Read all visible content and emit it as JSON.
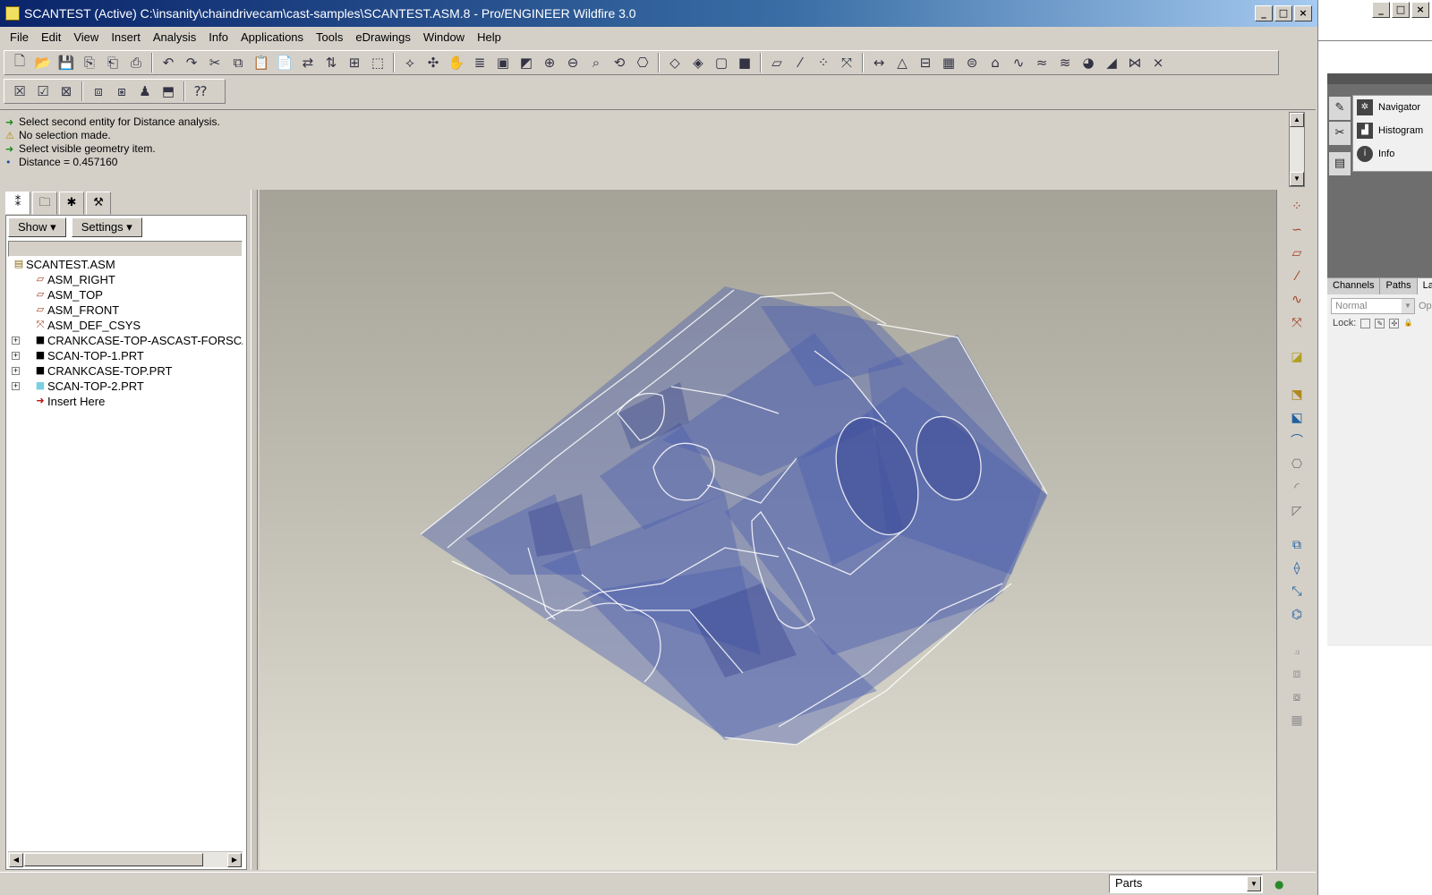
{
  "window": {
    "title": "SCANTEST (Active) C:\\insanity\\chaindrivecam\\cast-samples\\SCANTEST.ASM.8 - Pro/ENGINEER Wildfire 3.0",
    "minimize": "_",
    "maximize": "□",
    "close": "×"
  },
  "menu": [
    "File",
    "Edit",
    "View",
    "Insert",
    "Analysis",
    "Info",
    "Applications",
    "Tools",
    "eDrawings",
    "Window",
    "Help"
  ],
  "toolbar": {
    "icons": [
      "new-icon",
      "open-icon",
      "save-icon",
      "print-icon",
      "undo-icon",
      "redo-icon",
      "cut-icon",
      "copy-icon",
      "paste-icon",
      "regenerate-icon",
      "find-icon",
      "select-box-icon",
      "datum-icon",
      "orient-icon",
      "pan-icon",
      "layer-icon",
      "repaint-icon",
      "zoom-in-icon",
      "zoom-out-icon",
      "refit-icon",
      "spin-center-icon",
      "named-views-icon",
      "wireframe-icon",
      "hidden-line-icon",
      "no-hidden-icon",
      "shaded-icon",
      "datum-planes-icon",
      "datum-axes-icon",
      "datum-points-icon",
      "csys-icon",
      "measure-icon",
      "model-analysis-icon",
      "curve-analysis-icon",
      "surface-analysis-icon"
    ]
  },
  "messages": [
    {
      "icon": "arrow",
      "text": "Select second entity for Distance analysis."
    },
    {
      "icon": "warning",
      "text": "No selection made."
    },
    {
      "icon": "arrow",
      "text": "Select visible geometry item."
    },
    {
      "icon": "bullet",
      "text": "Distance = 0.457160"
    }
  ],
  "tree": {
    "show_label": "Show",
    "settings_label": "Settings",
    "items": [
      {
        "label": "SCANTEST.ASM",
        "icon": "assembly-icon",
        "level": 0,
        "expandable": false
      },
      {
        "label": "ASM_RIGHT",
        "icon": "datum-plane-icon",
        "level": 1,
        "expandable": false
      },
      {
        "label": "ASM_TOP",
        "icon": "datum-plane-icon",
        "level": 1,
        "expandable": false
      },
      {
        "label": "ASM_FRONT",
        "icon": "datum-plane-icon",
        "level": 1,
        "expandable": false
      },
      {
        "label": "ASM_DEF_CSYS",
        "icon": "csys-icon",
        "level": 1,
        "expandable": false
      },
      {
        "label": "CRANKCASE-TOP-ASCAST-FORSCAN",
        "icon": "part-black-icon",
        "level": 1,
        "expandable": true
      },
      {
        "label": "SCAN-TOP-1.PRT",
        "icon": "part-black-icon",
        "level": 1,
        "expandable": true
      },
      {
        "label": "CRANKCASE-TOP.PRT",
        "icon": "part-black-icon",
        "level": 1,
        "expandable": true
      },
      {
        "label": "SCAN-TOP-2.PRT",
        "icon": "part-cyan-icon",
        "level": 1,
        "expandable": true
      },
      {
        "label": "Insert Here",
        "icon": "insert-arrow-icon",
        "level": 1,
        "expandable": false
      }
    ]
  },
  "status": {
    "filter_value": "Parts"
  },
  "side_window": {
    "panels": [
      "Navigator",
      "Histogram",
      "Info"
    ],
    "layer_tabs": [
      "Channels",
      "Paths",
      "La"
    ],
    "blend_mode": "Normal",
    "opacity_label": "Op",
    "lock_label": "Lock:"
  },
  "colors": {
    "title_gradient_start": "#0a246a",
    "model_blue": "#4a5cad",
    "viewport_top": "#a5a398",
    "viewport_bottom": "#e4e2d6"
  }
}
